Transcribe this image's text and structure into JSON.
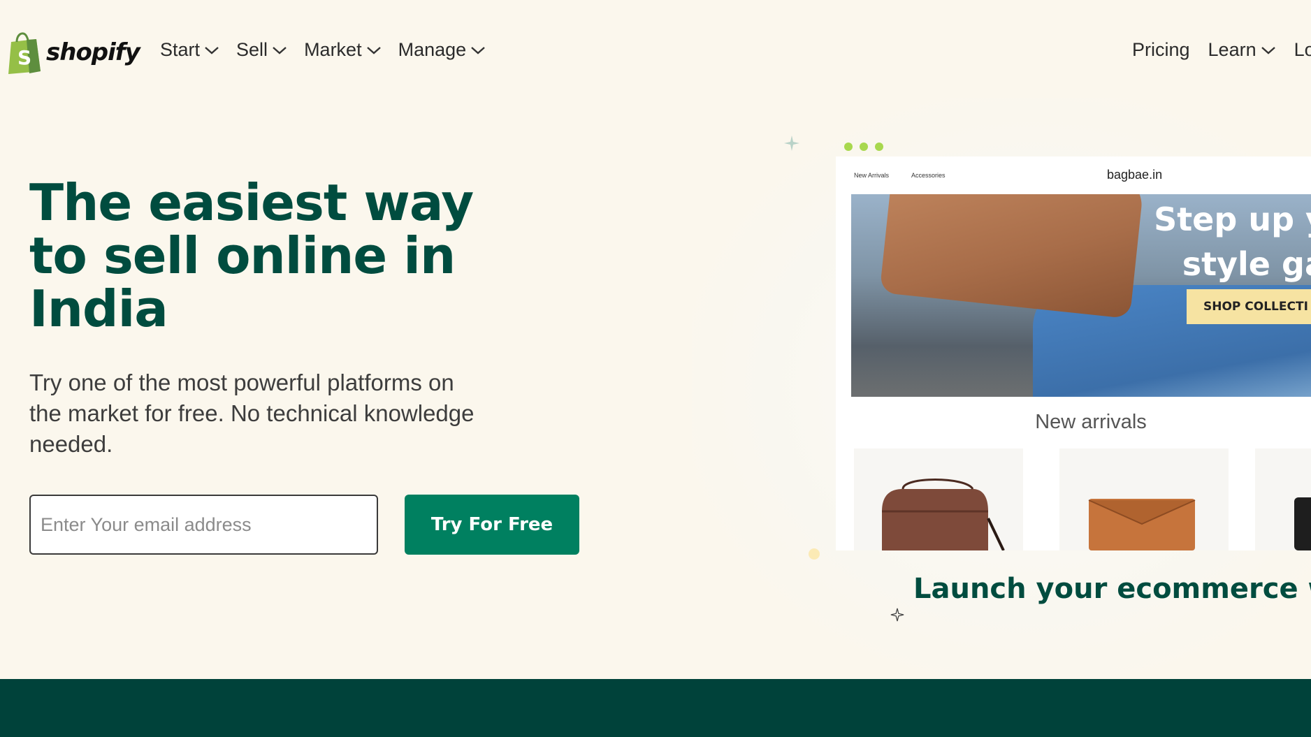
{
  "brand": {
    "name": "shopify",
    "green": "#95bf47",
    "dark_green": "#004c3f",
    "cta_green": "#008060",
    "band_color": "#00423a"
  },
  "nav": {
    "left": [
      {
        "label": "Start",
        "icon": "chevron-down-icon"
      },
      {
        "label": "Sell",
        "icon": "chevron-down-icon"
      },
      {
        "label": "Market",
        "icon": "chevron-down-icon"
      },
      {
        "label": "Manage",
        "icon": "chevron-down-icon"
      }
    ],
    "right": [
      {
        "label": "Pricing"
      },
      {
        "label": "Learn",
        "icon": "chevron-down-icon"
      },
      {
        "label": "Lo"
      }
    ]
  },
  "hero": {
    "title": "The easiest way to sell online in India",
    "subtitle": "Try one of the most powerful platforms on the market for free. No technical knowledge needed.",
    "email_placeholder": "Enter Your email address",
    "cta_label": "Try For Free"
  },
  "mockup": {
    "store_nav": [
      "New Arrivals",
      "Accessories"
    ],
    "domain": "bagbae.in",
    "banner_lines": [
      "Step up y",
      "style ga"
    ],
    "shop_button": "SHOP COLLECTI",
    "section_title": "New arrivals",
    "products": [
      "brown-crossbody-bag",
      "tan-clutch",
      "black-bag"
    ]
  },
  "caption": "Launch your ecommerce web"
}
